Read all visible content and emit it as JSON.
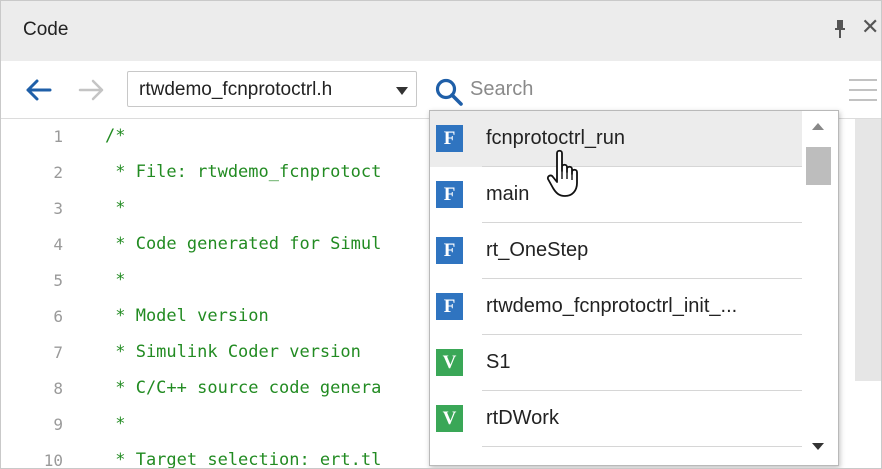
{
  "panel": {
    "title": "Code",
    "pin_icon": "pin-icon",
    "close_label": "✕"
  },
  "toolbar": {
    "back_icon": "arrow-left-icon",
    "forward_icon": "arrow-right-icon",
    "file_selector": {
      "value": "rtwdemo_fcnprotoctrl.h"
    },
    "search": {
      "placeholder": "Search",
      "value": ""
    },
    "menu_icon": "hamburger-icon"
  },
  "code": {
    "lines": [
      {
        "num": "1",
        "text": "/*"
      },
      {
        "num": "2",
        "text": " * File: rtwdemo_fcnprotoct"
      },
      {
        "num": "3",
        "text": " *"
      },
      {
        "num": "4",
        "text": " * Code generated for Simul"
      },
      {
        "num": "5",
        "text": " *"
      },
      {
        "num": "6",
        "text": " * Model version"
      },
      {
        "num": "7",
        "text": " * Simulink Coder version"
      },
      {
        "num": "8",
        "text": " * C/C++ source code genera"
      },
      {
        "num": "9",
        "text": " *"
      },
      {
        "num": "10",
        "text": " * Target selection: ert.tl"
      }
    ]
  },
  "autocomplete": {
    "items": [
      {
        "kind": "F",
        "label": "fcnprotoctrl_run",
        "hovered": true
      },
      {
        "kind": "F",
        "label": "main"
      },
      {
        "kind": "F",
        "label": "rt_OneStep"
      },
      {
        "kind": "F",
        "label": "rtwdemo_fcnprotoctrl_init_..."
      },
      {
        "kind": "V",
        "label": "S1"
      },
      {
        "kind": "V",
        "label": "rtDWork"
      }
    ]
  },
  "colors": {
    "function_badge": "#2f74c0",
    "variable_badge": "#3aa757",
    "comment_text": "#228b22",
    "accent": "#1f5fa8"
  }
}
